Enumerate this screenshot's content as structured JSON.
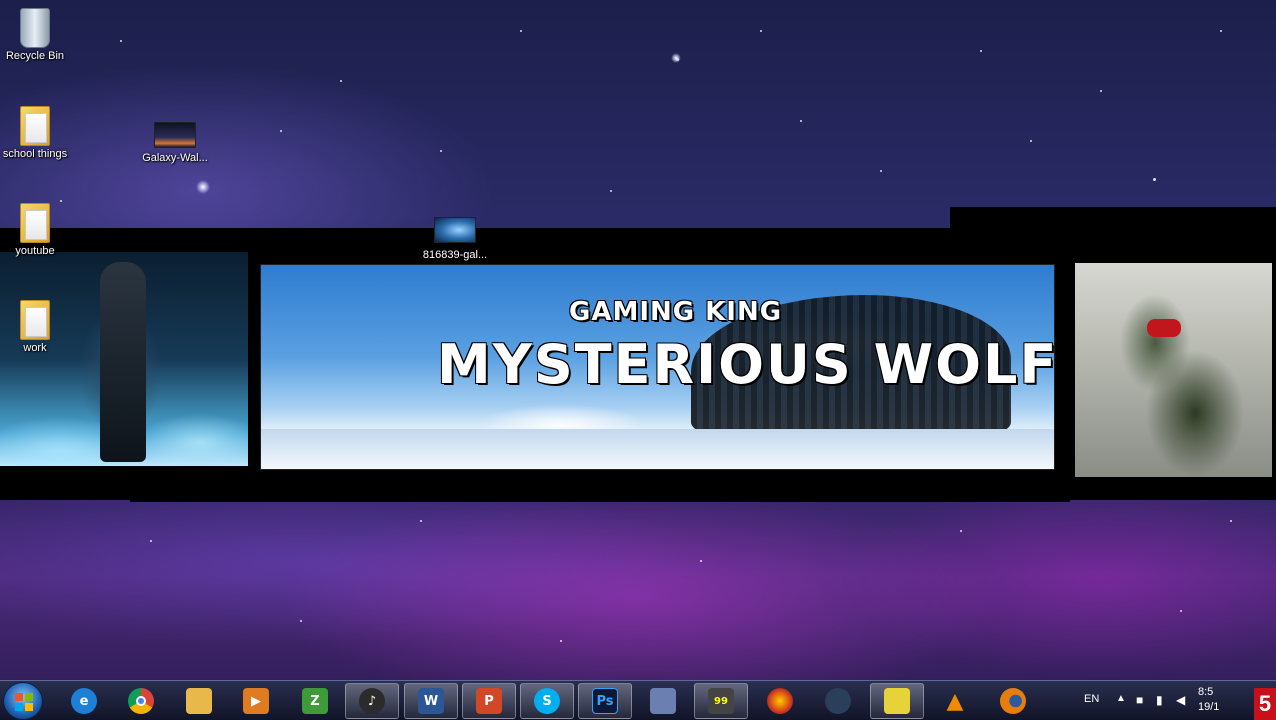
{
  "desktop": {
    "icons": [
      {
        "label": "Recycle Bin",
        "icon": "recycle-bin-icon"
      },
      {
        "label": "school things",
        "icon": "folder-icon"
      },
      {
        "label": "Galaxy-Wal...",
        "icon": "image-thumbnail-icon"
      },
      {
        "label": "youtube",
        "icon": "folder-icon"
      },
      {
        "label": "816839-gal...",
        "icon": "image-thumbnail-icon"
      },
      {
        "label": "work",
        "icon": "folder-icon"
      }
    ]
  },
  "banner": {
    "subtitle": "GAMING KING",
    "title": "MYSTERIOUS WOLF"
  },
  "taskbar": {
    "start_icon": "windows-start-icon",
    "apps": [
      {
        "name": "internet-explorer",
        "glyph": "e",
        "color": "#1e7fd6"
      },
      {
        "name": "chrome",
        "glyph": "",
        "color": "#db4437"
      },
      {
        "name": "file-explorer",
        "glyph": "",
        "color": "#e8b84a"
      },
      {
        "name": "media-player",
        "glyph": "▶",
        "color": "#e07b21"
      },
      {
        "name": "filezilla",
        "glyph": "Z",
        "color": "#3f9a3a"
      },
      {
        "name": "music-app",
        "glyph": "♪",
        "color": "#2b2b2b"
      },
      {
        "name": "word",
        "glyph": "W",
        "color": "#2b5797"
      },
      {
        "name": "powerpoint",
        "glyph": "P",
        "color": "#d24726"
      },
      {
        "name": "skype",
        "glyph": "S",
        "color": "#00aff0"
      },
      {
        "name": "photoshop",
        "glyph": "Ps",
        "color": "#0c1a35"
      },
      {
        "name": "paint",
        "glyph": "",
        "color": "#6b7fb0"
      },
      {
        "name": "monitor-app",
        "glyph": "99",
        "color": "#444"
      },
      {
        "name": "game-app",
        "glyph": "",
        "color": "#d23a1a"
      },
      {
        "name": "steam",
        "glyph": "",
        "color": "#2a3f5a"
      },
      {
        "name": "notes-app",
        "glyph": "",
        "color": "#e6d33a"
      },
      {
        "name": "vlc",
        "glyph": "▲",
        "color": "#f08a00"
      },
      {
        "name": "blender",
        "glyph": "",
        "color": "#e87d0d"
      }
    ],
    "tray": {
      "language": "EN",
      "time": "8:5",
      "date": "19/1"
    },
    "recording_indicator": "5"
  }
}
